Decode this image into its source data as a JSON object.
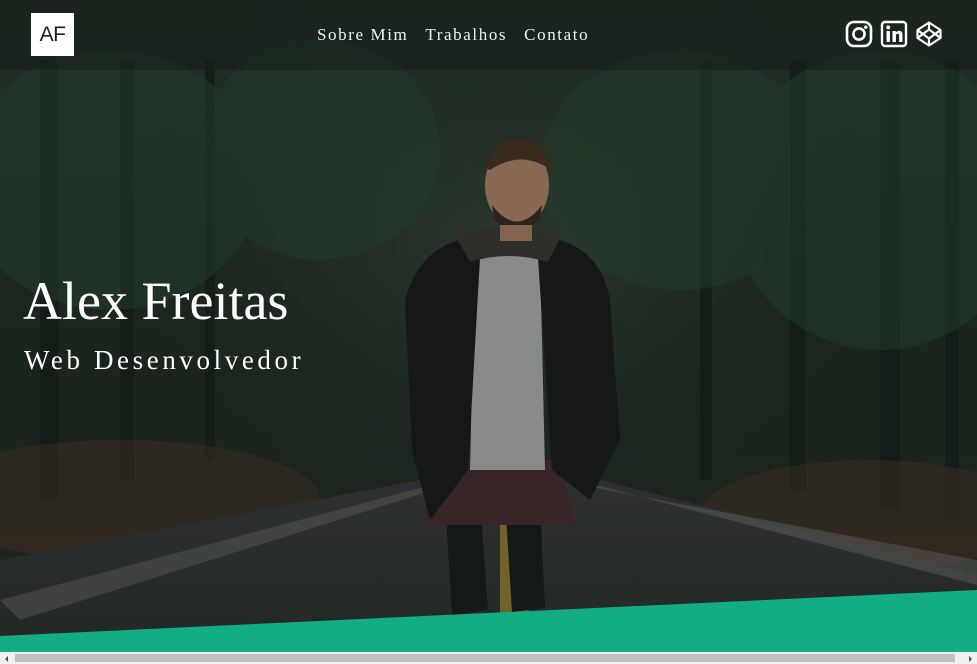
{
  "logo": {
    "text": "AF"
  },
  "nav": {
    "items": [
      {
        "label": "Sobre Mim"
      },
      {
        "label": "Trabalhos"
      },
      {
        "label": "Contato"
      }
    ]
  },
  "social": {
    "icons": [
      "instagram-icon",
      "linkedin-icon",
      "codepen-icon"
    ]
  },
  "hero": {
    "title": "Alex Freitas",
    "subtitle": "Web Desenvolvedor"
  },
  "colors": {
    "accent": "#12ad82",
    "nav_overlay": "#161e1a",
    "text": "#ffffff"
  }
}
